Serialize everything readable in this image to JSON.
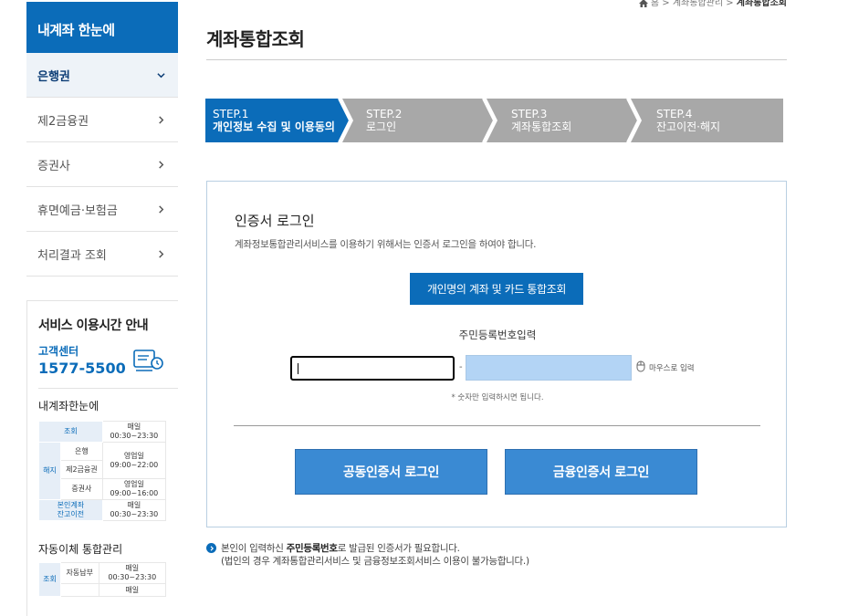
{
  "breadcrumb": {
    "home": "홈",
    "sep": ">",
    "level1": "계좌통합관리",
    "current": "계좌통합조회"
  },
  "sidebar": {
    "title": "내계좌 한눈에",
    "items": [
      {
        "label": "은행권",
        "active": true
      },
      {
        "label": "제2금융권",
        "active": false
      },
      {
        "label": "증권사",
        "active": false
      },
      {
        "label": "휴면예금·보험금",
        "active": false
      },
      {
        "label": "처리결과 조회",
        "active": false
      }
    ]
  },
  "service": {
    "title": "서비스 이용시간 안내",
    "cs_label": "고객센터",
    "cs_number": "1577-5500",
    "section1": "내계좌한눈에",
    "table1": {
      "inquiry": "조회",
      "inquiry_time1": "매일",
      "inquiry_time2": "00:30~23:30",
      "cancel": "해지",
      "bank": "은행",
      "bank_time1": "영업일",
      "bank_time2": "09:00~22:00",
      "fin2": "제2금융권",
      "sec": "증권사",
      "sec_time1": "영업일",
      "sec_time2": "09:00~16:00",
      "transfer1": "본인계좌",
      "transfer2": "잔고이전",
      "transfer_time1": "매일",
      "transfer_time2": "00:30~23:30"
    },
    "section2": "자동이체 통합관리",
    "table2": {
      "inquiry": "조회",
      "auto": "자동납부",
      "auto_time1": "매일",
      "auto_time2": "00:30~23:30",
      "next_time1": "매일"
    }
  },
  "page": {
    "title": "계좌통합조회"
  },
  "steps": [
    {
      "num": "STEP.1",
      "label": "개인정보 수집 및 이용동의",
      "active": true
    },
    {
      "num": "STEP.2",
      "label": "로그인",
      "active": false
    },
    {
      "num": "STEP.3",
      "label": "계좌통합조회",
      "active": false
    },
    {
      "num": "STEP.4",
      "label": "잔고이전·해지",
      "active": false
    }
  ],
  "login": {
    "title": "인증서 로그인",
    "description": "계좌정보통합관리서비스를 이용하기 위해서는 인증서 로그인을 하여야 합니다.",
    "query_button": "개인명의 계좌 및 카드 통합조회",
    "jumin_label": "주민등록번호입력",
    "dash": "-",
    "mouse_input": "마우스로 입력",
    "hint": "* 숫자만 입력하시면 됩니다.",
    "cert_button1": "공동인증서 로그인",
    "cert_button2": "금융인증서 로그인"
  },
  "notice": {
    "line1_pre": "본인이 입력하신 ",
    "line1_bold": "주민등록번호",
    "line1_post": "로 발급된 인증서가 필요합니다.",
    "line2": "(법인의 경우 계좌통합관리서비스 및 금융정보조회서비스 이용이 불가능합니다.)"
  },
  "colors": {
    "primary": "#0b6cb9",
    "step_inactive": "#a8a8a8",
    "cert_button": "#3a8ad3",
    "jumin_back": "#b3d4f5"
  }
}
